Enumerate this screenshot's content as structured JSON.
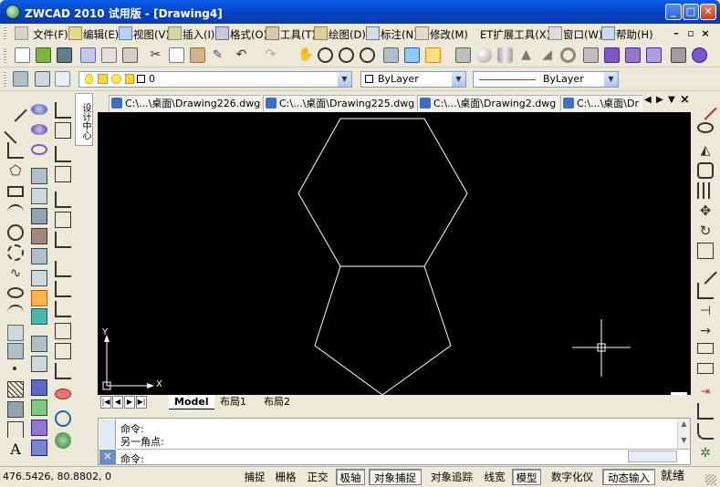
{
  "title": "ZWCAD 2010 试用版 - [Drawing4]",
  "window_controls": {
    "minimize": "_",
    "maximize": "□",
    "close": "✕"
  },
  "menu": [
    "文件(F)",
    "编辑(E)",
    "视图(V)",
    "插入(I)",
    "格式(O)",
    "工具(T)",
    "绘图(D)",
    "标注(N)",
    "修改(M)",
    "ET扩展工具(X)",
    "窗口(W)",
    "帮助(H)"
  ],
  "mdi_controls": {
    "minimize": "–",
    "restore": "▫",
    "close": "×"
  },
  "layer_combo": "0",
  "color_combo": "ByLayer",
  "linetype_combo": "ByLayer",
  "sidebar_tab": "设计中心",
  "doc_tabs": [
    "C:\\...\\桌面\\Drawing226.dwg",
    "C:\\...\\桌面\\Drawing225.dwg",
    "C:\\...\\桌面\\Drawing2.dwg",
    "C:\\...\\桌面\\Dr"
  ],
  "tab_nav": {
    "left": "◀",
    "right": "▶",
    "menu": "▼",
    "close": "×"
  },
  "ucs": {
    "x": "X",
    "y": "Y"
  },
  "layout_nav": [
    "|◀",
    "◀",
    "▶",
    "▶|"
  ],
  "layout_tabs": [
    "Model",
    "布局1",
    "布局2"
  ],
  "command": {
    "history": [
      "命令:",
      "另一角点:"
    ],
    "prompt": "命令:"
  },
  "coordinates": "476.5426,  80.8802,  0",
  "status_buttons": [
    {
      "label": "捕捉",
      "on": false
    },
    {
      "label": "栅格",
      "on": false
    },
    {
      "label": "正交",
      "on": false
    },
    {
      "label": "极轴",
      "on": true
    },
    {
      "label": "对象捕捉",
      "on": true
    },
    {
      "label": "对象追踪",
      "on": false
    },
    {
      "label": "线宽",
      "on": false
    },
    {
      "label": "模型",
      "on": true
    },
    {
      "label": "数字化仪",
      "on": false
    },
    {
      "label": "动态输入",
      "on": true
    }
  ],
  "status_text": "就绪",
  "colors": {
    "title_bar": "#0a5ee8",
    "canvas": "#000000",
    "drawing_line": "#ffffff",
    "chrome": "#ece9d8"
  }
}
